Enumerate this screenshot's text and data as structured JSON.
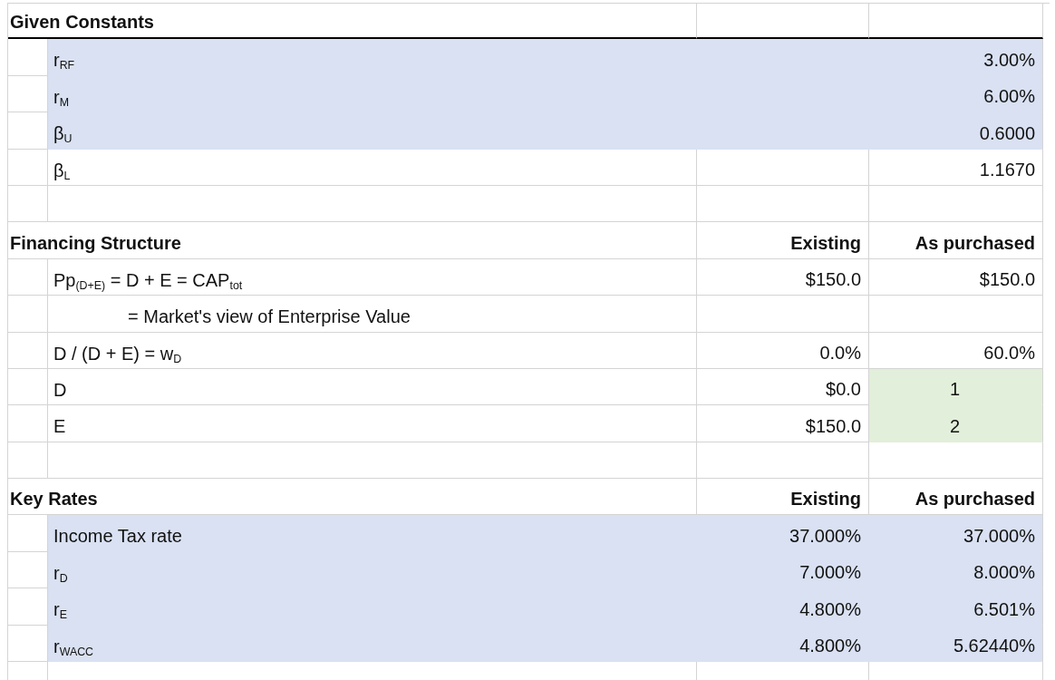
{
  "sections": [
    {
      "title": "Given Constants",
      "rule": true,
      "rows": [
        {
          "kind": "item",
          "label": "r$_{RF}$",
          "highlighted": true,
          "as_purchased": "3.00%"
        },
        {
          "kind": "item",
          "label": "r$_{M}$",
          "highlighted": true,
          "as_purchased": "6.00%"
        },
        {
          "kind": "item",
          "label": "β$_{U}$",
          "highlighted": true,
          "as_purchased": "0.6000"
        },
        {
          "kind": "item",
          "label": "β$_{L}$",
          "highlighted": false,
          "as_purchased": "1.1670"
        },
        {
          "kind": "blank"
        }
      ]
    },
    {
      "title": "Financing Structure",
      "rule": false,
      "columns": [
        "Existing",
        "As purchased"
      ],
      "rows": [
        {
          "kind": "item",
          "label": "Pp$_{(D+E)}$ = D + E = CAP$_{tot}$",
          "highlighted": false,
          "existing": "$150.0",
          "as_purchased": "$150.0"
        },
        {
          "kind": "item",
          "label": "= Market's view of Enterprise Value",
          "indented": true,
          "highlighted": false
        },
        {
          "kind": "item",
          "label": "D / (D + E) = w$_{D}$",
          "highlighted": false,
          "existing": "0.0%",
          "as_purchased": "60.0%"
        },
        {
          "kind": "item",
          "label": "D",
          "highlighted": false,
          "existing": "$0.0",
          "as_purchased": "1",
          "input": true
        },
        {
          "kind": "item",
          "label": "E",
          "highlighted": false,
          "existing": "$150.0",
          "as_purchased": "2",
          "input": true
        },
        {
          "kind": "blank"
        }
      ]
    },
    {
      "title": "Key Rates",
      "rule": false,
      "columns": [
        "Existing",
        "As purchased"
      ],
      "rows": [
        {
          "kind": "item",
          "label": "Income Tax rate",
          "highlighted": true,
          "existing": "37.000%",
          "as_purchased": "37.000%"
        },
        {
          "kind": "item",
          "label": "r$_{D}$",
          "highlighted": true,
          "existing": "7.000%",
          "as_purchased": "8.000%"
        },
        {
          "kind": "item",
          "label": "r$_{E}$",
          "highlighted": true,
          "existing": "4.800%",
          "as_purchased": "6.501%"
        },
        {
          "kind": "item",
          "label": "r$_{WACC}$",
          "highlighted": true,
          "existing": "4.800%",
          "as_purchased": "5.62440%"
        },
        {
          "kind": "blank"
        }
      ]
    }
  ]
}
